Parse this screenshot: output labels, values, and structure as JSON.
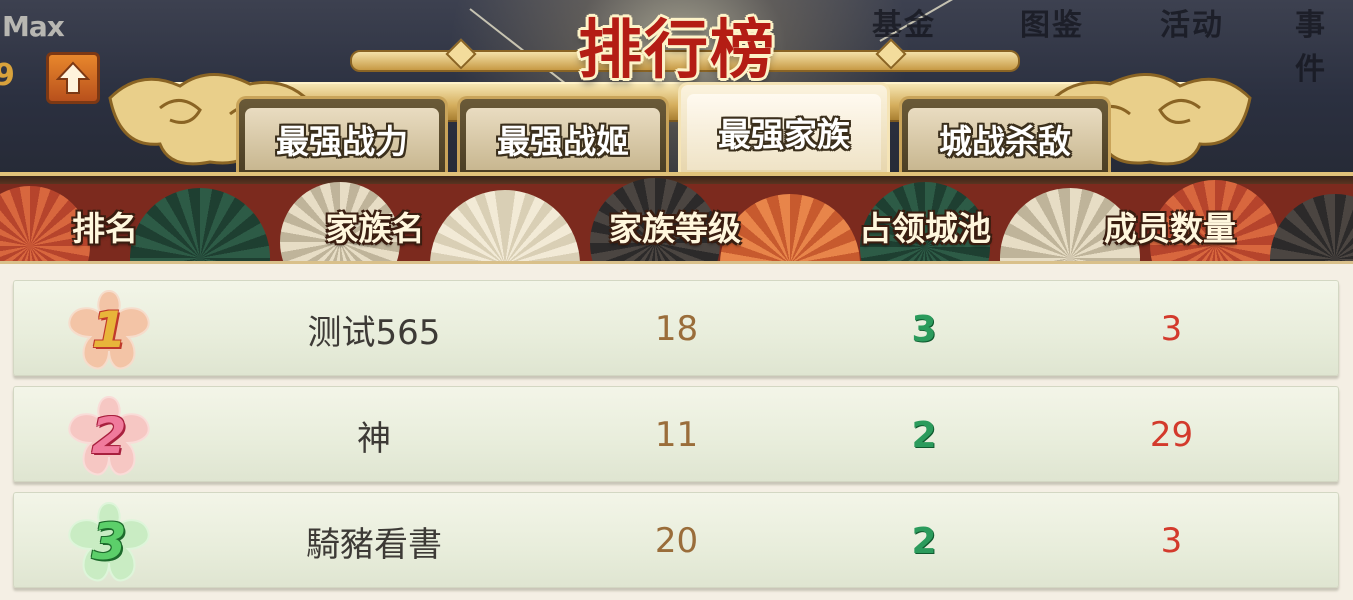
{
  "title": "排行榜",
  "player": {
    "level_label": "Max",
    "level_num": "9"
  },
  "background_menu": [
    "基金",
    "图鉴",
    "活动",
    "事件"
  ],
  "tabs": [
    {
      "label": "最强战力",
      "active": false
    },
    {
      "label": "最强战姬",
      "active": false
    },
    {
      "label": "最强家族",
      "active": true
    },
    {
      "label": "城战杀敌",
      "active": false
    }
  ],
  "columns": {
    "rank": "排名",
    "family_name": "家族名",
    "family_level": "家族等级",
    "cities": "占领城池",
    "members": "成员数量"
  },
  "rows": [
    {
      "rank": "1",
      "name": "测试565",
      "level": "18",
      "cities": "3",
      "members": "3",
      "badge_color": "#f3c4a6",
      "num_color": "#e8b53a"
    },
    {
      "rank": "2",
      "name": "神",
      "level": "11",
      "cities": "2",
      "members": "29",
      "badge_color": "#f6c7c3",
      "num_color": "#e0456a"
    },
    {
      "rank": "3",
      "name": "騎豬看書",
      "level": "20",
      "cities": "2",
      "members": "3",
      "badge_color": "#c9ecc3",
      "num_color": "#2ea64a"
    }
  ],
  "colors": {
    "title_red": "#b41d14",
    "cities_green": "#2b9b5c",
    "members_red": "#d33a2c",
    "level_brown": "#9a6d3a"
  }
}
